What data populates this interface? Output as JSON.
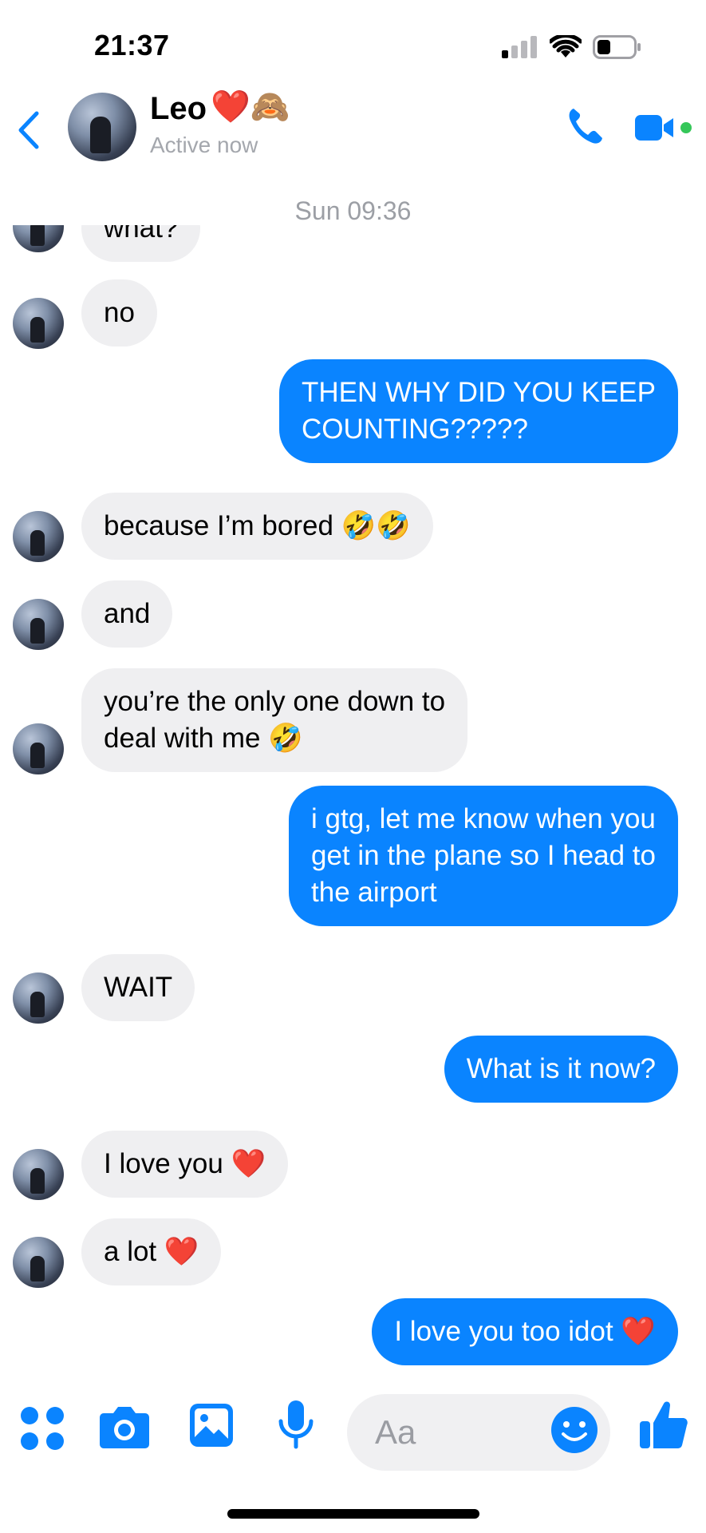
{
  "status_bar": {
    "time": "21:37",
    "signal_icon": "cellular-signal-icon",
    "wifi_icon": "wifi-icon",
    "battery_icon": "battery-icon"
  },
  "header": {
    "contact_name": "Leo",
    "name_emojis": "❤️🙈",
    "status": "Active now",
    "back_icon": "chevron-left-icon",
    "call_icon": "phone-icon",
    "video_icon": "video-camera-icon",
    "active_dot_color": "#35c759"
  },
  "conversation": {
    "timestamp": "Sun 09:36",
    "messages": [
      {
        "from": "them",
        "text": "what?"
      },
      {
        "from": "them",
        "text": "no"
      },
      {
        "from": "me",
        "text": "THEN WHY DID YOU KEEP\nCOUNTING?????"
      },
      {
        "from": "them",
        "text": "because I’m bored 🤣🤣"
      },
      {
        "from": "them",
        "text": "and"
      },
      {
        "from": "them",
        "text": "you’re the only one down to\ndeal with me 🤣"
      },
      {
        "from": "me",
        "text": "i gtg, let me know when you\nget in the plane so I head to\nthe airport"
      },
      {
        "from": "them",
        "text": "WAIT"
      },
      {
        "from": "me",
        "text": "What is it now?"
      },
      {
        "from": "them",
        "text": "I love you ❤️"
      },
      {
        "from": "them",
        "text": "a lot ❤️"
      },
      {
        "from": "me",
        "text": "I love you too idot ❤️"
      }
    ]
  },
  "composer": {
    "placeholder": "Aa",
    "tools": [
      "grid-menu-icon",
      "camera-icon",
      "gallery-icon",
      "microphone-icon"
    ],
    "emoji_icon": "smiley-icon",
    "like_icon": "thumbs-up-icon"
  },
  "colors": {
    "accent": "#0a84ff",
    "incoming_bubble": "#efeff1",
    "muted_text": "#9c9fa5"
  }
}
